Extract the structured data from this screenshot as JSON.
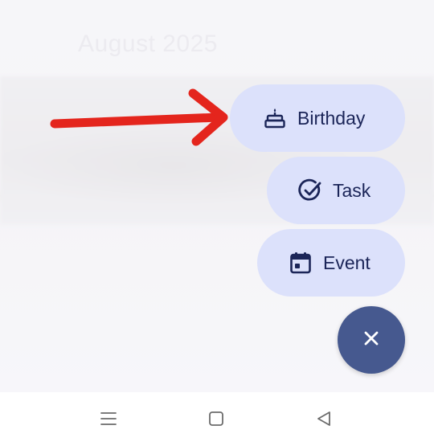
{
  "background": {
    "month_title": "August 2025",
    "list_items": [
      "",
      "",
      "",
      ""
    ]
  },
  "fab_menu": {
    "items": [
      {
        "label": "Birthday",
        "icon": "cake-icon"
      },
      {
        "label": "Task",
        "icon": "check-circle-icon"
      },
      {
        "label": "Event",
        "icon": "calendar-icon"
      }
    ],
    "close_icon": "close-icon"
  },
  "annotation": {
    "icon": "red-arrow",
    "color": "#e4251d"
  },
  "colors": {
    "chip_bg": "#dce1fb",
    "chip_text": "#1b2558",
    "fab_bg": "#46598f"
  },
  "system_nav": {
    "buttons": [
      "recents-icon",
      "home-icon",
      "back-icon"
    ]
  }
}
